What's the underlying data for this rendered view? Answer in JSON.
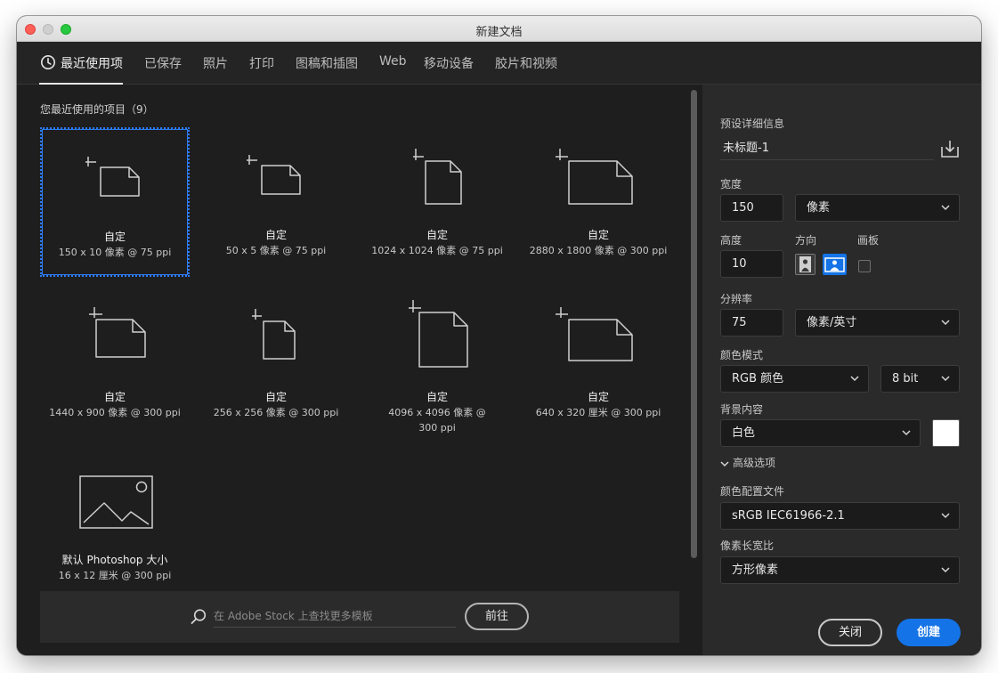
{
  "window": {
    "title": "新建文档"
  },
  "tabs": [
    {
      "label": "最近使用项",
      "active": true
    },
    {
      "label": "已保存"
    },
    {
      "label": "照片"
    },
    {
      "label": "打印"
    },
    {
      "label": "图稿和插图"
    },
    {
      "label": "Web"
    },
    {
      "label": "移动设备"
    },
    {
      "label": "胶片和视频"
    }
  ],
  "recent": {
    "title": "您最近使用的项目（9）",
    "presets": [
      {
        "name": "自定",
        "dims": "150 x 10 像素 @ 75 ppi",
        "selected": true
      },
      {
        "name": "自定",
        "dims": "50 x 5 像素 @ 75 ppi"
      },
      {
        "name": "自定",
        "dims": "1024 x 1024 像素 @ 75 ppi"
      },
      {
        "name": "自定",
        "dims": "2880 x 1800 像素 @ 300 ppi"
      },
      {
        "name": "自定",
        "dims": "1440 x 900 像素 @ 300 ppi"
      },
      {
        "name": "自定",
        "dims": "256 x 256 像素 @ 300 ppi"
      },
      {
        "name": "自定",
        "dims": "4096 x 4096 像素 @ 300 ppi"
      },
      {
        "name": "自定",
        "dims": "640 x 320 厘米 @ 300 ppi"
      },
      {
        "name": "默认 Photoshop 大小",
        "dims": "16 x 12 厘米 @ 300 ppi",
        "icon": "image-icon"
      }
    ]
  },
  "stock": {
    "placeholder": "在 Adobe Stock 上查找更多模板",
    "go_label": "前往"
  },
  "details": {
    "title": "预设详细信息",
    "name": "未标题-1",
    "width_label": "宽度",
    "width_value": "150",
    "width_unit": "像素",
    "height_label": "高度",
    "height_value": "10",
    "orientation_label": "方向",
    "artboard_label": "画板",
    "resolution_label": "分辨率",
    "resolution_value": "75",
    "resolution_unit": "像素/英寸",
    "color_mode_label": "颜色模式",
    "color_mode_value": "RGB 颜色",
    "bit_depth_value": "8 bit",
    "background_label": "背景内容",
    "background_value": "白色",
    "advanced_label": "高级选项",
    "profile_label": "颜色配置文件",
    "profile_value": "sRGB IEC61966-2.1",
    "aspect_label": "像素长宽比",
    "aspect_value": "方形像素",
    "close_label": "关闭",
    "create_label": "创建"
  },
  "colors": {
    "accent": "#1473e6",
    "selection": "#2d7bf4",
    "background_swatch": "#ffffff"
  }
}
